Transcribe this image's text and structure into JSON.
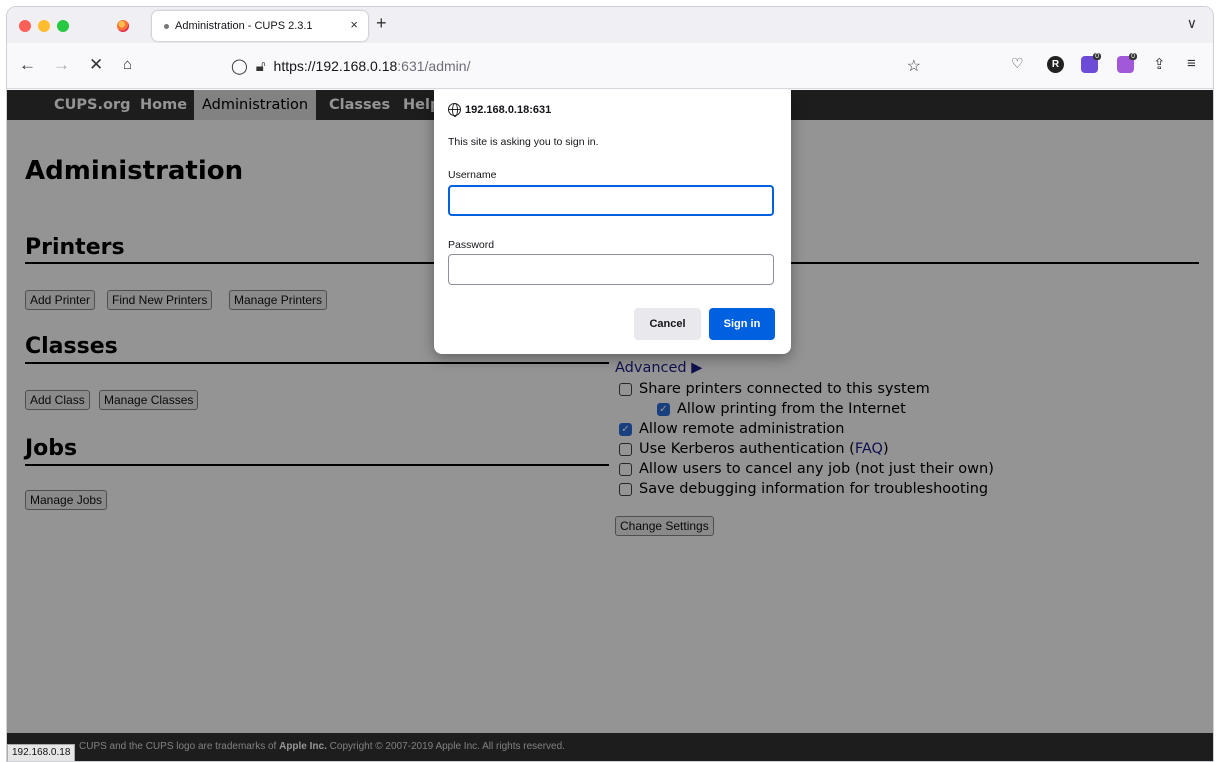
{
  "browser": {
    "tab_title": "Administration - CUPS 2.3.1",
    "tab_close": "×",
    "new_tab": "+",
    "tab_list": "∨",
    "url_host": "https://192.168.0.18",
    "url_rest": ":631/admin/",
    "extension_badge": "0",
    "extension_r": "R"
  },
  "cups_nav": {
    "items": [
      "CUPS.org",
      "Home",
      "Administration",
      "Classes",
      "Help"
    ]
  },
  "page": {
    "title": "Administration",
    "printers_heading": "Printers",
    "printers_buttons": [
      "Add Printer",
      "Find New Printers",
      "Manage Printers"
    ],
    "classes_heading": "Classes",
    "classes_buttons": [
      "Add Class",
      "Manage Classes"
    ],
    "jobs_heading": "Jobs",
    "jobs_buttons": [
      "Manage Jobs"
    ],
    "advanced_link": "Advanced ▶",
    "settings": [
      {
        "label": "Share printers connected to this system",
        "checked": false
      },
      {
        "label": "Allow printing from the Internet",
        "checked": true
      },
      {
        "label": "Allow remote administration",
        "checked": true
      },
      {
        "label": "Use Kerberos authentication (",
        "link": "FAQ",
        "suffix": ")",
        "checked": false
      },
      {
        "label": "Allow users to cancel any job (not just their own)",
        "checked": false
      },
      {
        "label": "Save debugging information for troubleshooting",
        "checked": false
      }
    ],
    "change_settings_button": "Change Settings"
  },
  "footer": {
    "text_prefix": "CUPS and the CUPS logo are trademarks of ",
    "apple": "Apple Inc.",
    "text_suffix": " Copyright © 2007-2019 Apple Inc. All rights reserved.",
    "status_url": "192.168.0.18"
  },
  "dialog": {
    "host": "192.168.0.18:631",
    "message": "This site is asking you to sign in.",
    "username_label": "Username",
    "password_label": "Password",
    "cancel_label": "Cancel",
    "signin_label": "Sign in"
  },
  "colors": {
    "accent": "#0061e0",
    "cups_nav_bg": "#333333",
    "link": "#1c1c8a"
  }
}
